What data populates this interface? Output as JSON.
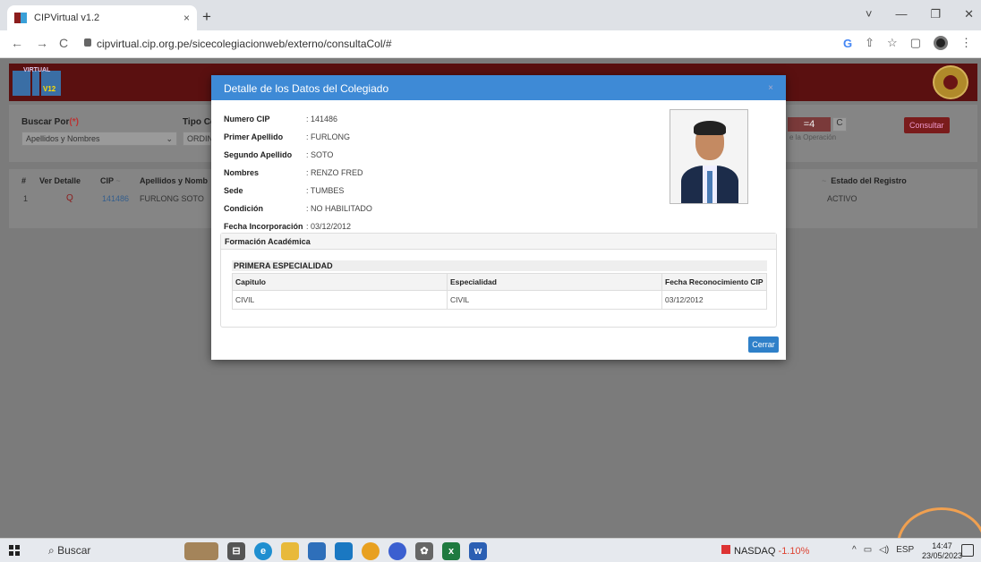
{
  "browser": {
    "tab_title": "CIPVirtual v1.2",
    "tab_close": "×",
    "new_tab": "+",
    "url": "cipvirtual.cip.org.pe/sicecolegiacionweb/externo/consultaCol/#",
    "window_controls": [
      "˅",
      "—",
      "❐",
      "✕"
    ]
  },
  "header": {
    "logo_virtual": "VIRTUAL",
    "logo_version": "V12"
  },
  "filter": {
    "buscar_por_label": "Buscar Por",
    "required_mark": "(*)",
    "buscar_por_value": "Apellidos y Nombres",
    "tipo_label": "Tipo Col",
    "tipo_value": "ORDIN",
    "captcha_value": "=4",
    "refresh_icon": "C",
    "operation_hint": "e la Operación",
    "consultar_label": "Consultar"
  },
  "grid": {
    "headers": {
      "num": "#",
      "ver_detalle": "Ver Detalle",
      "cip": "CIP",
      "apellidos": "Apellidos y Nomb",
      "estado": "Estado del Registro"
    },
    "sort_glyph": "~",
    "row": {
      "num": "1",
      "cip": "141486",
      "apellidos": "FURLONG SOTO",
      "estado": "ACTIVO"
    }
  },
  "modal": {
    "title": "Detalle de los Datos del Colegiado",
    "close_glyph": "×",
    "fields": [
      {
        "label": "Numero CIP",
        "value": ": 141486"
      },
      {
        "label": "Primer Apellido",
        "value": ": FURLONG"
      },
      {
        "label": "Segundo Apellido",
        "value": ": SOTO"
      },
      {
        "label": "Nombres",
        "value": ": RENZO FRED"
      },
      {
        "label": "Sede",
        "value": ": TUMBES"
      },
      {
        "label": "Condición",
        "value": ": NO HABILITADO"
      },
      {
        "label": "Fecha Incorporación",
        "value": ": 03/12/2012"
      }
    ],
    "formacion_title": "Formación Académica",
    "especialidad_title": "PRIMERA ESPECIALIDAD",
    "table_headers": [
      "Capitulo",
      "Especialidad",
      "Fecha Reconocimiento CIP"
    ],
    "table_row": [
      "CIVIL",
      "CIVIL",
      "03/12/2012"
    ],
    "cerrar_label": "Cerrar"
  },
  "taskbar": {
    "search_label": "Buscar",
    "nasdaq_label": "NASDAQ",
    "nasdaq_change": "-1.10%",
    "tray_lang": "ESP",
    "time": "14:47",
    "date": "23/05/2023"
  },
  "colors": {
    "brand_dark_red": "#5a1010",
    "modal_header": "#3e8ad6",
    "highlight_ring": "#f0a050"
  }
}
